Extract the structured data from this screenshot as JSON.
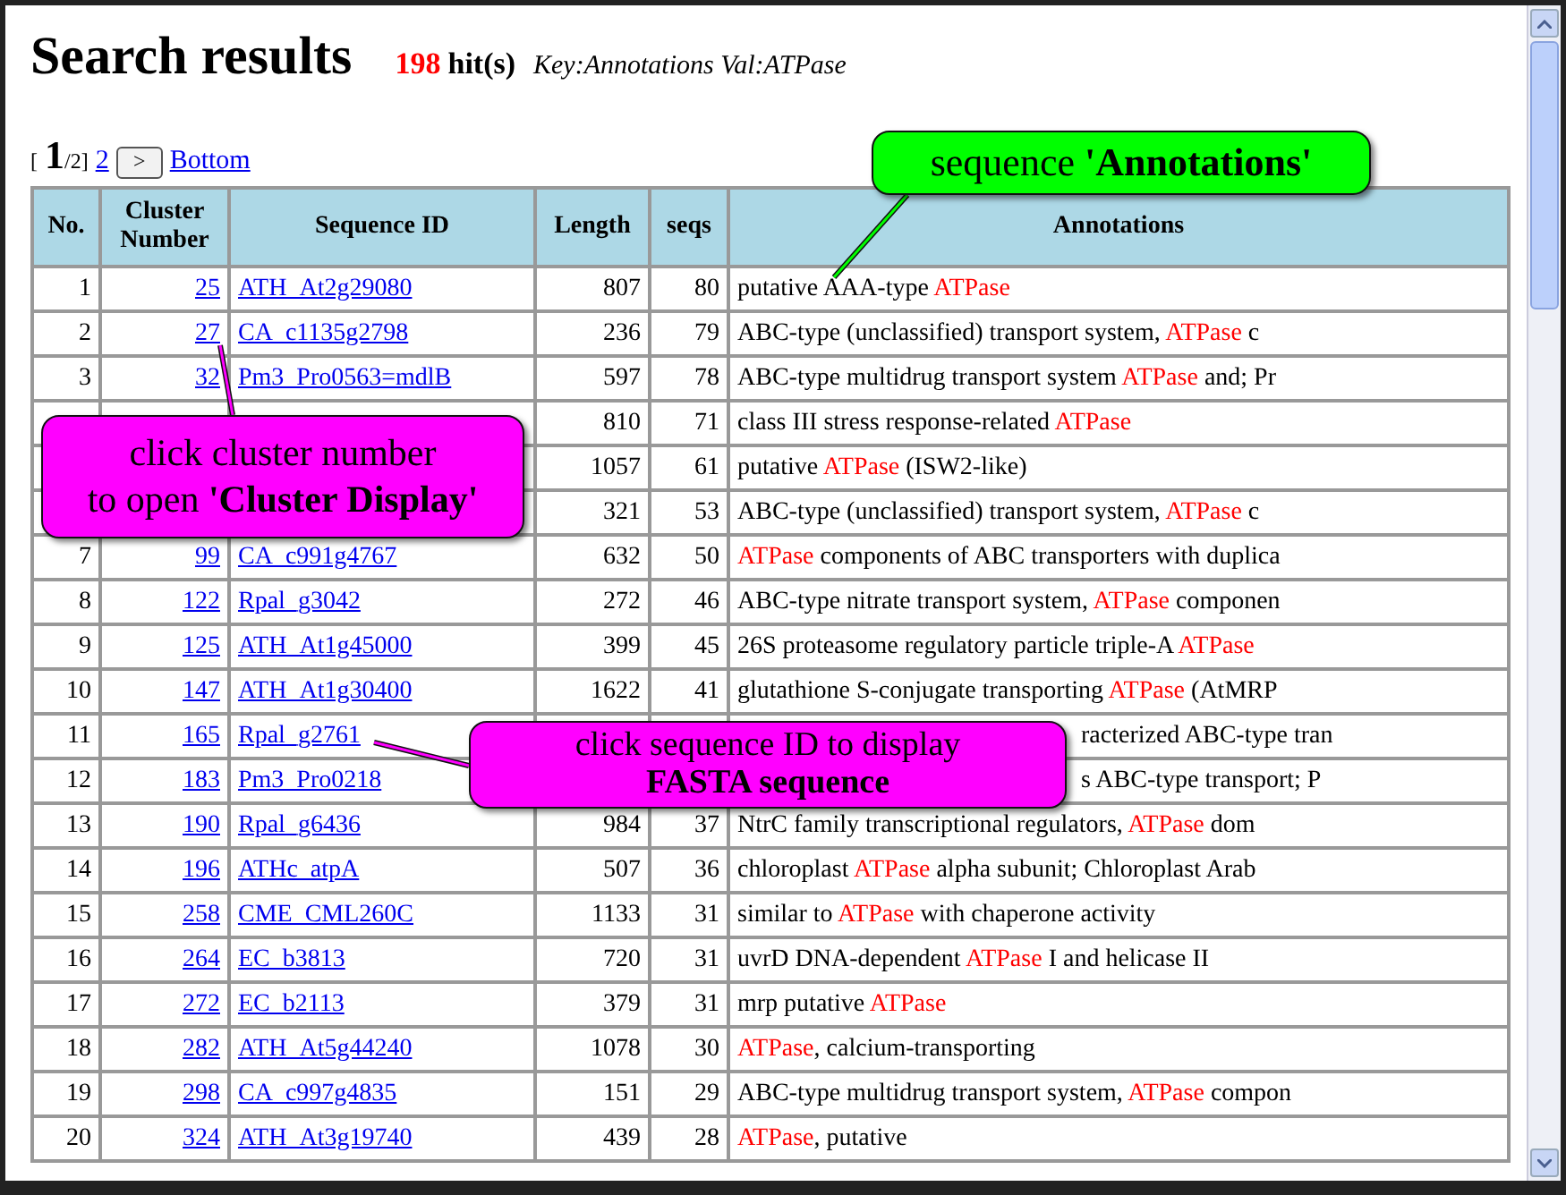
{
  "heading": {
    "title": "Search results",
    "hits": "198",
    "hits_label": "hit(s)",
    "query": "Key:Annotations Val:ATPase"
  },
  "pager": {
    "open": "[",
    "current": "1",
    "total": "/2]",
    "pages": [
      "2"
    ],
    "next": ">",
    "bottom": "Bottom"
  },
  "table": {
    "columns": [
      "No.",
      "Cluster Number",
      "Sequence ID",
      "Length",
      "seqs",
      "Annotations"
    ],
    "rows": [
      {
        "no": "1",
        "cluster": "25",
        "seq_id": "ATH_At2g29080",
        "length": "807",
        "seqs": "80",
        "annotation": [
          {
            "text": "putative AAA-type "
          },
          {
            "text": "ATPase",
            "highlight": true
          }
        ]
      },
      {
        "no": "2",
        "cluster": "27",
        "seq_id": "CA_c1135g2798",
        "length": "236",
        "seqs": "79",
        "annotation": [
          {
            "text": "ABC-type (unclassified) transport system, "
          },
          {
            "text": "ATPase",
            "highlight": true
          },
          {
            "text": " c"
          }
        ]
      },
      {
        "no": "3",
        "cluster": "32",
        "seq_id": "Pm3_Pro0563=mdlB",
        "length": "597",
        "seqs": "78",
        "annotation": [
          {
            "text": "ABC-type multidrug transport system "
          },
          {
            "text": "ATPase",
            "highlight": true
          },
          {
            "text": " and; Pr"
          }
        ]
      },
      {
        "length": "810",
        "seqs": "71",
        "annotation": [
          {
            "text": "class III stress response-related "
          },
          {
            "text": "ATPase",
            "highlight": true
          }
        ]
      },
      {
        "length": "1057",
        "seqs": "61",
        "annotation": [
          {
            "text": "putative "
          },
          {
            "text": "ATPase",
            "highlight": true
          },
          {
            "text": " (ISW2-like)"
          }
        ]
      },
      {
        "length": "321",
        "seqs": "53",
        "annotation": [
          {
            "text": "ABC-type (unclassified) transport system, "
          },
          {
            "text": "ATPase",
            "highlight": true
          },
          {
            "text": " c"
          }
        ]
      },
      {
        "no": "7",
        "cluster": "99",
        "seq_id": "CA_c991g4767",
        "length": "632",
        "seqs": "50",
        "annotation": [
          {
            "text": "ATPase",
            "highlight": true
          },
          {
            "text": " components of ABC transporters with duplica"
          }
        ]
      },
      {
        "no": "8",
        "cluster": "122",
        "seq_id": "Rpal_g3042",
        "length": "272",
        "seqs": "46",
        "annotation": [
          {
            "text": "ABC-type nitrate transport system, "
          },
          {
            "text": "ATPase",
            "highlight": true
          },
          {
            "text": " componen"
          }
        ]
      },
      {
        "no": "9",
        "cluster": "125",
        "seq_id": "ATH_At1g45000",
        "length": "399",
        "seqs": "45",
        "annotation": [
          {
            "text": "26S proteasome regulatory particle triple-A "
          },
          {
            "text": "ATPase",
            "highlight": true
          }
        ]
      },
      {
        "no": "10",
        "cluster": "147",
        "seq_id": "ATH_At1g30400",
        "length": "1622",
        "seqs": "41",
        "annotation": [
          {
            "text": "glutathione S-conjugate transporting "
          },
          {
            "text": "ATPase",
            "highlight": true
          },
          {
            "text": " (AtMRP"
          }
        ]
      },
      {
        "no": "11",
        "cluster": "165",
        "seq_id": "Rpal_g2761",
        "annotation_covered": true,
        "annotation": [
          {
            "text": "racterized ABC-type tran"
          }
        ]
      },
      {
        "no": "12",
        "cluster": "183",
        "seq_id": "Pm3_Pro0218",
        "annotation_covered": true,
        "annotation": [
          {
            "text": "s ABC-type transport; P"
          }
        ]
      },
      {
        "no": "13",
        "cluster": "190",
        "seq_id": "Rpal_g6436",
        "length": "984",
        "seqs": "37",
        "annotation": [
          {
            "text": "NtrC family transcriptional regulators, "
          },
          {
            "text": "ATPase",
            "highlight": true
          },
          {
            "text": " dom"
          }
        ]
      },
      {
        "no": "14",
        "cluster": "196",
        "seq_id": "ATHc_atpA",
        "length": "507",
        "seqs": "36",
        "annotation": [
          {
            "text": "chloroplast "
          },
          {
            "text": "ATPase",
            "highlight": true
          },
          {
            "text": " alpha subunit; Chloroplast Arab"
          }
        ]
      },
      {
        "no": "15",
        "cluster": "258",
        "seq_id": "CME_CML260C",
        "length": "1133",
        "seqs": "31",
        "annotation": [
          {
            "text": "similar to "
          },
          {
            "text": "ATPase",
            "highlight": true
          },
          {
            "text": " with chaperone activity"
          }
        ]
      },
      {
        "no": "16",
        "cluster": "264",
        "seq_id": "EC_b3813",
        "length": "720",
        "seqs": "31",
        "annotation": [
          {
            "text": "uvrD DNA-dependent "
          },
          {
            "text": "ATPase",
            "highlight": true
          },
          {
            "text": " I and helicase II"
          }
        ]
      },
      {
        "no": "17",
        "cluster": "272",
        "seq_id": "EC_b2113",
        "length": "379",
        "seqs": "31",
        "annotation": [
          {
            "text": "mrp putative "
          },
          {
            "text": "ATPase",
            "highlight": true
          }
        ]
      },
      {
        "no": "18",
        "cluster": "282",
        "seq_id": "ATH_At5g44240",
        "length": "1078",
        "seqs": "30",
        "annotation": [
          {
            "text": "ATPase",
            "highlight": true
          },
          {
            "text": ", calcium-transporting"
          }
        ]
      },
      {
        "no": "19",
        "cluster": "298",
        "seq_id": "CA_c997g4835",
        "length": "151",
        "seqs": "29",
        "annotation": [
          {
            "text": "ABC-type multidrug transport system, "
          },
          {
            "text": "ATPase",
            "highlight": true
          },
          {
            "text": " compon"
          }
        ]
      },
      {
        "no": "20",
        "cluster": "324",
        "seq_id": "ATH_At3g19740",
        "length": "439",
        "seqs": "28",
        "annotation": [
          {
            "text": "ATPase",
            "highlight": true
          },
          {
            "text": ", putative"
          }
        ]
      }
    ]
  },
  "callouts": [
    {
      "lines": [
        "sequence **'Annotations'**"
      ],
      "color": "#00ff00"
    },
    {
      "lines": [
        "click cluster number",
        "to open **'Cluster Display'**"
      ],
      "color": "#ff00ff"
    },
    {
      "lines": [
        "click sequence ID to display",
        "**FASTA sequence**"
      ],
      "color": "#ff00ff"
    }
  ]
}
